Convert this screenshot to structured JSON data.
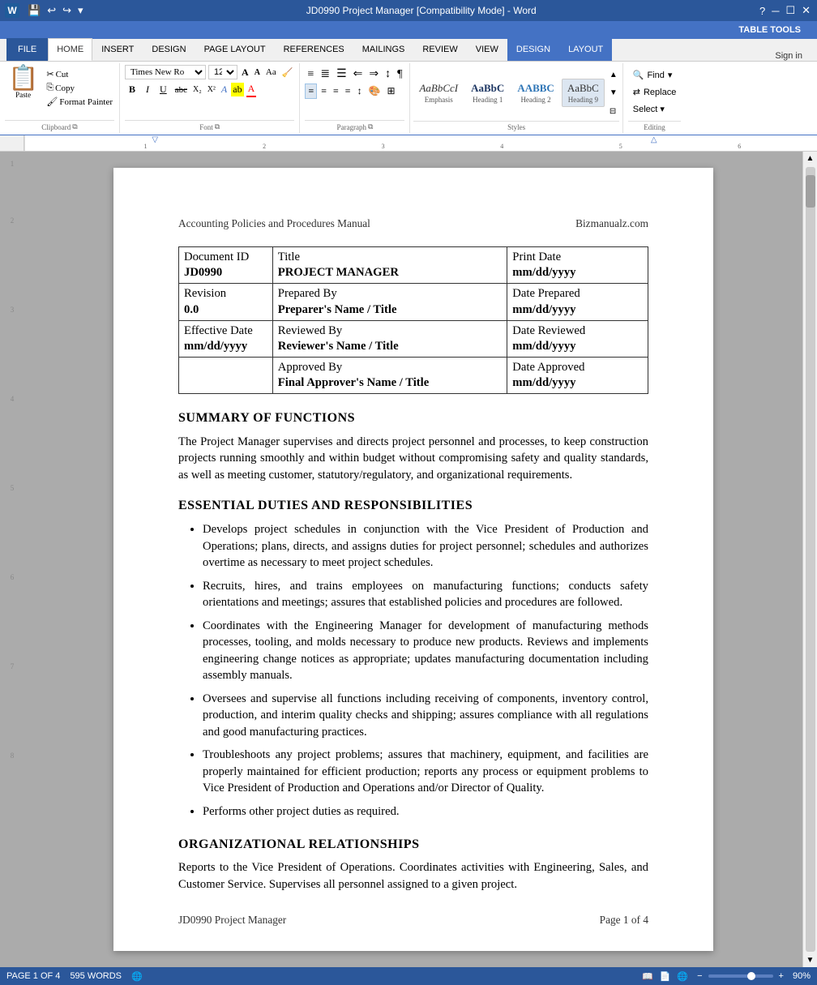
{
  "titleBar": {
    "appIcon": "W",
    "quickAccess": [
      "save",
      "undo",
      "redo",
      "customize"
    ],
    "title": "JD0990 Project Manager [Compatibility Mode] - Word",
    "tableTools": "TABLE TOOLS",
    "windowControls": [
      "minimize",
      "restore",
      "close"
    ],
    "helpIcon": "?"
  },
  "ribbon": {
    "tabs": [
      "FILE",
      "HOME",
      "INSERT",
      "DESIGN",
      "PAGE LAYOUT",
      "REFERENCES",
      "MAILINGS",
      "REVIEW",
      "VIEW",
      "DESIGN",
      "LAYOUT"
    ],
    "activeTab": "HOME",
    "tableToolsTabs": [
      "DESIGN",
      "LAYOUT"
    ],
    "signIn": "Sign in",
    "groups": {
      "clipboard": {
        "label": "Clipboard",
        "paste": "Paste",
        "cut": "Cut",
        "copy": "Copy",
        "formatPainter": "Format Painter"
      },
      "font": {
        "label": "Font",
        "fontFamily": "Times New Ro",
        "fontSize": "12",
        "grow": "A",
        "shrink": "A",
        "clearFormat": "A",
        "bold": "B",
        "italic": "I",
        "underline": "U",
        "strikethrough": "abc",
        "subscript": "X₂",
        "superscript": "X²",
        "textEffects": "A",
        "textHighlight": "ab",
        "fontColor": "A"
      },
      "paragraph": {
        "label": "Paragraph"
      },
      "styles": {
        "label": "Styles",
        "items": [
          {
            "preview": "AaBbCcI",
            "label": "Emphasis",
            "style": "italic"
          },
          {
            "preview": "AaBbC",
            "label": "Heading 1",
            "style": "heading1"
          },
          {
            "preview": "AABBC",
            "label": "Heading 2",
            "style": "heading2"
          },
          {
            "preview": "AaBbC",
            "label": "Heading 9",
            "style": "heading9"
          }
        ]
      },
      "editing": {
        "label": "Editing",
        "find": "Find",
        "replace": "Replace",
        "select": "Select ▾"
      }
    }
  },
  "document": {
    "header": {
      "left": "Accounting Policies and Procedures Manual",
      "right": "Bizmanualz.com"
    },
    "table": {
      "rows": [
        [
          {
            "label": "Document ID",
            "value": "JD0990",
            "width": "20%"
          },
          {
            "label": "Title",
            "value": "PROJECT MANAGER",
            "width": "50%"
          },
          {
            "label": "Print Date",
            "value": "mm/dd/yyyy",
            "width": "30%"
          }
        ],
        [
          {
            "label": "Revision",
            "value": "0.0",
            "width": "20%"
          },
          {
            "label": "Prepared By",
            "value": "Preparer's Name / Title",
            "width": "50%"
          },
          {
            "label": "Date Prepared",
            "value": "mm/dd/yyyy",
            "width": "30%"
          }
        ],
        [
          {
            "label": "Effective Date",
            "value": "mm/dd/yyyy",
            "width": "20%"
          },
          {
            "label": "Reviewed By",
            "value": "Reviewer's Name / Title",
            "width": "50%"
          },
          {
            "label": "Date Reviewed",
            "value": "mm/dd/yyyy",
            "width": "30%"
          }
        ],
        [
          {
            "label": "",
            "value": "",
            "width": "20%"
          },
          {
            "label": "Approved By",
            "value": "Final Approver's Name / Title",
            "width": "50%"
          },
          {
            "label": "Date Approved",
            "value": "mm/dd/yyyy",
            "width": "30%"
          }
        ]
      ]
    },
    "sections": [
      {
        "heading": "SUMMARY OF FUNCTIONS",
        "type": "paragraph",
        "text": "The Project Manager supervises and directs project personnel and processes, to keep construction projects running smoothly and within budget without compromising safety and quality standards, as well as meeting customer, statutory/regulatory, and organizational requirements."
      },
      {
        "heading": "ESSENTIAL DUTIES AND RESPONSIBILITIES",
        "type": "bullets",
        "items": [
          "Develops project schedules in conjunction with the Vice President of Production and Operations; plans, directs, and assigns duties for project personnel; schedules and authorizes overtime as necessary to meet project schedules.",
          "Recruits, hires, and trains employees on manufacturing functions; conducts safety orientations and meetings; assures that established policies and procedures are followed.",
          "Coordinates with the Engineering Manager for development of manufacturing methods processes, tooling, and molds necessary to produce new products. Reviews and implements engineering change notices as appropriate; updates manufacturing documentation including assembly manuals.",
          "Oversees and supervise all functions including receiving of components, inventory control, production, and interim quality checks and shipping; assures compliance with all regulations and good manufacturing practices.",
          "Troubleshoots any project problems; assures that machinery, equipment, and facilities are properly maintained for efficient production; reports any process or equipment problems to Vice President of Production and Operations and/or Director of Quality.",
          "Performs other project duties as required."
        ]
      },
      {
        "heading": "ORGANIZATIONAL RELATIONSHIPS",
        "type": "paragraph",
        "text": "Reports to the Vice President of Operations.  Coordinates activities with Engineering, Sales, and Customer Service.  Supervises all personnel assigned to a given project."
      }
    ],
    "footer": {
      "left": "JD0990 Project Manager",
      "right": "Page 1 of 4"
    }
  },
  "statusBar": {
    "pageInfo": "PAGE 1 OF 4",
    "wordCount": "595 WORDS",
    "language": "EN",
    "viewIcons": [
      "read",
      "print",
      "web"
    ],
    "zoom": "90%",
    "zoomMinus": "−",
    "zoomPlus": "+"
  }
}
